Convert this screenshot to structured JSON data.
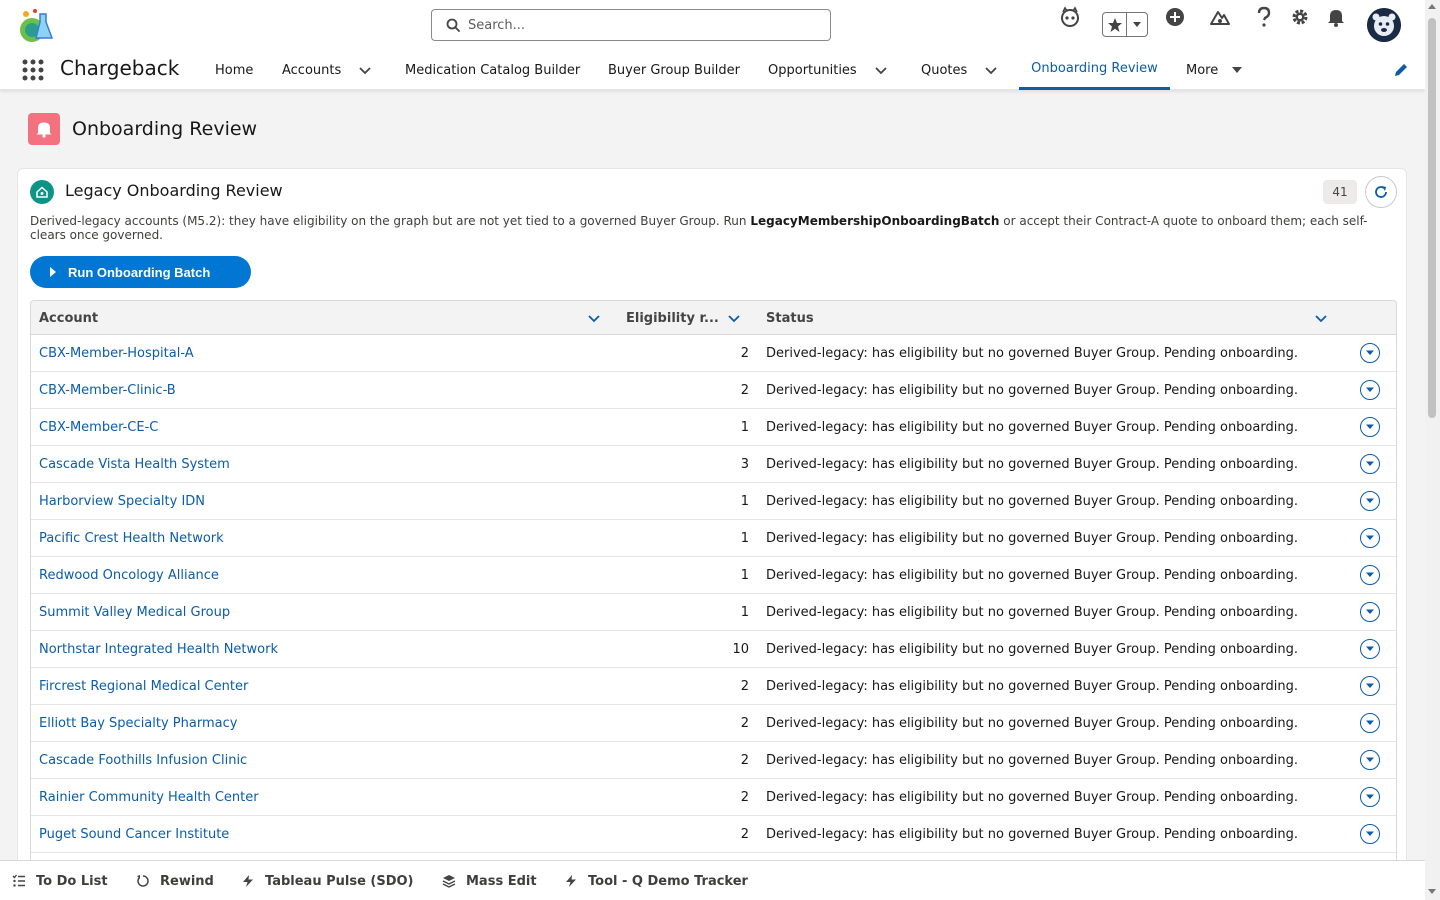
{
  "header": {
    "search_placeholder": "Search...",
    "icons": [
      "app-logo-icon",
      "search-icon",
      "agent-icon",
      "favorites-star-icon",
      "favorites-caret-icon",
      "add-icon",
      "trailhead-icon",
      "help-icon",
      "setup-gear-icon",
      "notifications-bell-icon",
      "user-avatar"
    ]
  },
  "nav": {
    "app_name": "Chargeback",
    "items": [
      {
        "label": "Home"
      },
      {
        "label": "Accounts"
      },
      {
        "label": "Medication Catalog Builder"
      },
      {
        "label": "Buyer Group Builder"
      },
      {
        "label": "Opportunities"
      },
      {
        "label": "Quotes"
      },
      {
        "label": "Onboarding Review"
      },
      {
        "label": "More"
      }
    ],
    "active": "Onboarding Review"
  },
  "page": {
    "title": "Onboarding Review"
  },
  "card": {
    "title": "Legacy Onboarding Review",
    "count": "41",
    "description_part1": "Derived-legacy accounts (M5.2): they have eligibility on the graph but are not yet tied to a governed Buyer Group. Run ",
    "description_bold": "LegacyMembershipOnboardingBatch",
    "description_part2": " or accept their Contract-A quote to onboard them; each self-clears once governed.",
    "run_button": "Run Onboarding Batch"
  },
  "table": {
    "columns": [
      "Account",
      "Eligibility r...",
      "Status"
    ],
    "rows": [
      {
        "account": "CBX-Member-Hospital-A",
        "eligibility": "2",
        "status": "Derived-legacy: has eligibility but no governed Buyer Group. Pending onboarding."
      },
      {
        "account": "CBX-Member-Clinic-B",
        "eligibility": "2",
        "status": "Derived-legacy: has eligibility but no governed Buyer Group. Pending onboarding."
      },
      {
        "account": "CBX-Member-CE-C",
        "eligibility": "1",
        "status": "Derived-legacy: has eligibility but no governed Buyer Group. Pending onboarding."
      },
      {
        "account": "Cascade Vista Health System",
        "eligibility": "3",
        "status": "Derived-legacy: has eligibility but no governed Buyer Group. Pending onboarding."
      },
      {
        "account": "Harborview Specialty IDN",
        "eligibility": "1",
        "status": "Derived-legacy: has eligibility but no governed Buyer Group. Pending onboarding."
      },
      {
        "account": "Pacific Crest Health Network",
        "eligibility": "1",
        "status": "Derived-legacy: has eligibility but no governed Buyer Group. Pending onboarding."
      },
      {
        "account": "Redwood Oncology Alliance",
        "eligibility": "1",
        "status": "Derived-legacy: has eligibility but no governed Buyer Group. Pending onboarding."
      },
      {
        "account": "Summit Valley Medical Group",
        "eligibility": "1",
        "status": "Derived-legacy: has eligibility but no governed Buyer Group. Pending onboarding."
      },
      {
        "account": "Northstar Integrated Health Network",
        "eligibility": "10",
        "status": "Derived-legacy: has eligibility but no governed Buyer Group. Pending onboarding."
      },
      {
        "account": "Fircrest Regional Medical Center",
        "eligibility": "2",
        "status": "Derived-legacy: has eligibility but no governed Buyer Group. Pending onboarding."
      },
      {
        "account": "Elliott Bay Specialty Pharmacy",
        "eligibility": "2",
        "status": "Derived-legacy: has eligibility but no governed Buyer Group. Pending onboarding."
      },
      {
        "account": "Cascade Foothills Infusion Clinic",
        "eligibility": "2",
        "status": "Derived-legacy: has eligibility but no governed Buyer Group. Pending onboarding."
      },
      {
        "account": "Rainier Community Health Center",
        "eligibility": "2",
        "status": "Derived-legacy: has eligibility but no governed Buyer Group. Pending onboarding."
      },
      {
        "account": "Puget Sound Cancer Institute",
        "eligibility": "2",
        "status": "Derived-legacy: has eligibility but no governed Buyer Group. Pending onboarding."
      }
    ]
  },
  "utility_bar": {
    "items": [
      {
        "label": "To Do List",
        "icon": "list-icon"
      },
      {
        "label": "Rewind",
        "icon": "rewind-icon"
      },
      {
        "label": "Tableau Pulse (SDO)",
        "icon": "bolt-icon"
      },
      {
        "label": "Mass Edit",
        "icon": "layers-icon"
      },
      {
        "label": "Tool - Q Demo Tracker",
        "icon": "bolt-icon"
      }
    ]
  },
  "colors": {
    "brand_blue": "#0176d3",
    "link_blue": "#0b5cab",
    "page_icon": "#f4727f",
    "card_icon": "#0d9488"
  }
}
